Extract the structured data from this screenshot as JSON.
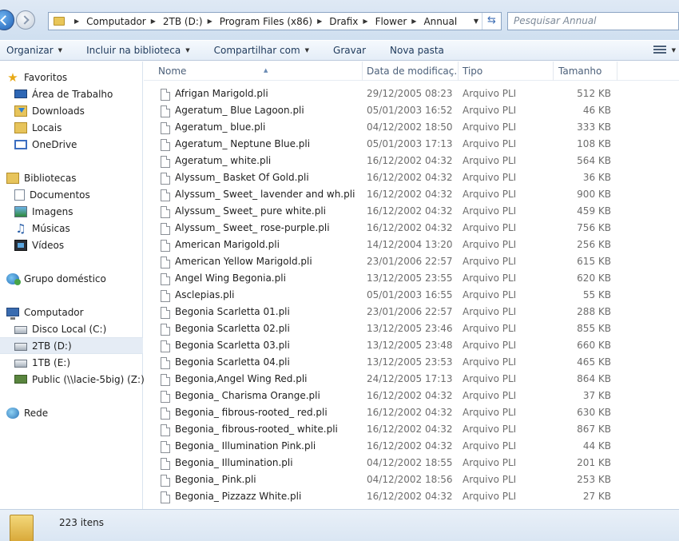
{
  "address": {
    "crumbs": [
      "Computador",
      "2TB (D:)",
      "Program Files (x86)",
      "Drafix",
      "Flower",
      "Annual"
    ],
    "search_placeholder": "Pesquisar Annual"
  },
  "toolbar": {
    "organize": "Organizar",
    "include_library": "Incluir na biblioteca",
    "share_with": "Compartilhar com",
    "burn": "Gravar",
    "new_folder": "Nova pasta"
  },
  "nav": {
    "favorites": {
      "label": "Favoritos",
      "items": [
        "Área de Trabalho",
        "Downloads",
        "Locais",
        "OneDrive"
      ]
    },
    "libraries": {
      "label": "Bibliotecas",
      "items": [
        "Documentos",
        "Imagens",
        "Músicas",
        "Vídeos"
      ]
    },
    "homegroup": "Grupo doméstico",
    "computer": {
      "label": "Computador",
      "items": [
        "Disco Local (C:)",
        "2TB (D:)",
        "1TB (E:)",
        "Public (\\\\lacie-5big) (Z:)"
      ]
    },
    "network": "Rede"
  },
  "columns": {
    "name": "Nome",
    "date": "Data de modificaç...",
    "type": "Tipo",
    "size": "Tamanho"
  },
  "files": [
    {
      "name": "Afrigan Marigold.pli",
      "date": "29/12/2005 08:23",
      "type": "Arquivo PLI",
      "size": "512 KB"
    },
    {
      "name": "Ageratum_ Blue Lagoon.pli",
      "date": "05/01/2003 16:52",
      "type": "Arquivo PLI",
      "size": "46 KB"
    },
    {
      "name": "Ageratum_ blue.pli",
      "date": "04/12/2002 18:50",
      "type": "Arquivo PLI",
      "size": "333 KB"
    },
    {
      "name": "Ageratum_ Neptune Blue.pli",
      "date": "05/01/2003 17:13",
      "type": "Arquivo PLI",
      "size": "108 KB"
    },
    {
      "name": "Ageratum_ white.pli",
      "date": "16/12/2002 04:32",
      "type": "Arquivo PLI",
      "size": "564 KB"
    },
    {
      "name": "Alyssum_ Basket Of Gold.pli",
      "date": "16/12/2002 04:32",
      "type": "Arquivo PLI",
      "size": "36 KB"
    },
    {
      "name": "Alyssum_ Sweet_ lavender and wh.pli",
      "date": "16/12/2002 04:32",
      "type": "Arquivo PLI",
      "size": "900 KB"
    },
    {
      "name": "Alyssum_ Sweet_ pure white.pli",
      "date": "16/12/2002 04:32",
      "type": "Arquivo PLI",
      "size": "459 KB"
    },
    {
      "name": "Alyssum_ Sweet_ rose-purple.pli",
      "date": "16/12/2002 04:32",
      "type": "Arquivo PLI",
      "size": "756 KB"
    },
    {
      "name": "American Marigold.pli",
      "date": "14/12/2004 13:20",
      "type": "Arquivo PLI",
      "size": "256 KB"
    },
    {
      "name": "American Yellow Marigold.pli",
      "date": "23/01/2006 22:57",
      "type": "Arquivo PLI",
      "size": "615 KB"
    },
    {
      "name": "Angel Wing Begonia.pli",
      "date": "13/12/2005 23:55",
      "type": "Arquivo PLI",
      "size": "620 KB"
    },
    {
      "name": "Asclepias.pli",
      "date": "05/01/2003 16:55",
      "type": "Arquivo PLI",
      "size": "55 KB"
    },
    {
      "name": "Begonia Scarletta 01.pli",
      "date": "23/01/2006 22:57",
      "type": "Arquivo PLI",
      "size": "288 KB"
    },
    {
      "name": "Begonia Scarletta 02.pli",
      "date": "13/12/2005 23:46",
      "type": "Arquivo PLI",
      "size": "855 KB"
    },
    {
      "name": "Begonia Scarletta 03.pli",
      "date": "13/12/2005 23:48",
      "type": "Arquivo PLI",
      "size": "660 KB"
    },
    {
      "name": "Begonia Scarletta 04.pli",
      "date": "13/12/2005 23:53",
      "type": "Arquivo PLI",
      "size": "465 KB"
    },
    {
      "name": "Begonia,Angel Wing Red.pli",
      "date": "24/12/2005 17:13",
      "type": "Arquivo PLI",
      "size": "864 KB"
    },
    {
      "name": "Begonia_ Charisma Orange.pli",
      "date": "16/12/2002 04:32",
      "type": "Arquivo PLI",
      "size": "37 KB"
    },
    {
      "name": "Begonia_ fibrous-rooted_ red.pli",
      "date": "16/12/2002 04:32",
      "type": "Arquivo PLI",
      "size": "630 KB"
    },
    {
      "name": "Begonia_ fibrous-rooted_ white.pli",
      "date": "16/12/2002 04:32",
      "type": "Arquivo PLI",
      "size": "867 KB"
    },
    {
      "name": "Begonia_ Illumination Pink.pli",
      "date": "16/12/2002 04:32",
      "type": "Arquivo PLI",
      "size": "44 KB"
    },
    {
      "name": "Begonia_ Illumination.pli",
      "date": "04/12/2002 18:55",
      "type": "Arquivo PLI",
      "size": "201 KB"
    },
    {
      "name": "Begonia_ Pink.pli",
      "date": "04/12/2002 18:56",
      "type": "Arquivo PLI",
      "size": "253 KB"
    },
    {
      "name": "Begonia_ Pizzazz White.pli",
      "date": "16/12/2002 04:32",
      "type": "Arquivo PLI",
      "size": "27 KB"
    }
  ],
  "status": {
    "count": "223 itens"
  }
}
